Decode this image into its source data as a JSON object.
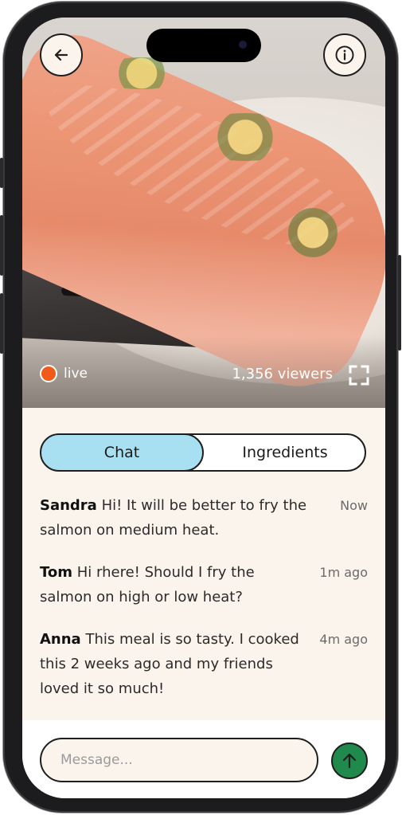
{
  "stream": {
    "live_label": "live",
    "viewers_label": "1,356 viewers"
  },
  "icons": {
    "back": "arrow-left-icon",
    "info": "info-icon",
    "fullscreen": "fullscreen-icon",
    "send": "arrow-up-icon",
    "live": "live-dot-icon"
  },
  "tabs": [
    {
      "label": "Chat",
      "active": true
    },
    {
      "label": "Ingredients",
      "active": false
    }
  ],
  "messages": [
    {
      "author": "Sandra",
      "text": "Hi! It will be better to fry the salmon on medium heat.",
      "time": "Now"
    },
    {
      "author": "Tom",
      "text": "Hi rhere! Should I fry the salmon on high or low heat?",
      "time": "1m ago"
    },
    {
      "author": "Anna",
      "text": "This meal is so tasty. I cooked this 2 weeks ago and my friends  loved it so much!",
      "time": "4m ago"
    }
  ],
  "composer": {
    "placeholder": "Message..."
  },
  "colors": {
    "panel_bg": "#fbf4ec",
    "active_tab": "#a8e0f2",
    "send_button": "#1f8a4c",
    "live_dot": "#f25a1c"
  }
}
